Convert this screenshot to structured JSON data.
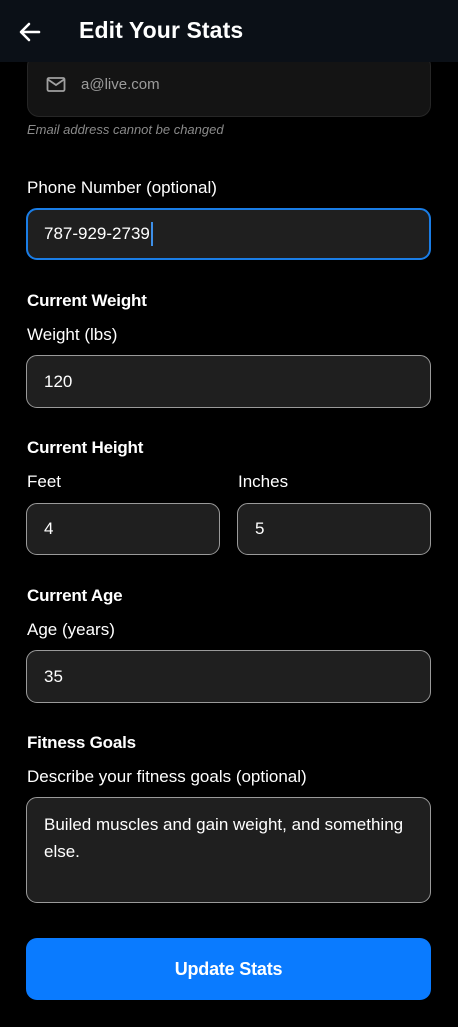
{
  "header": {
    "title": "Edit Your Stats",
    "back_icon": "arrow-left-icon"
  },
  "email": {
    "icon": "mail-icon",
    "value": "a@live.com",
    "note": "Email address cannot be changed"
  },
  "phone": {
    "label": "Phone Number (optional)",
    "value": "787-929-2739"
  },
  "weight": {
    "section_title": "Current Weight",
    "label": "Weight (lbs)",
    "value": "120"
  },
  "height": {
    "section_title": "Current Height",
    "feet_label": "Feet",
    "feet_value": "4",
    "inches_label": "Inches",
    "inches_value": "5"
  },
  "age": {
    "section_title": "Current Age",
    "label": "Age (years)",
    "value": "35"
  },
  "goals": {
    "section_title": "Fitness Goals",
    "label": "Describe your fitness goals (optional)",
    "value": "Builed muscles and gain weight, and something else."
  },
  "submit": {
    "label": "Update Stats"
  },
  "colors": {
    "accent": "#0a7bff",
    "focus_border": "#1a7de6",
    "background": "#000000",
    "header_bg": "#0b1017",
    "field_bg": "#1f1f1f"
  }
}
